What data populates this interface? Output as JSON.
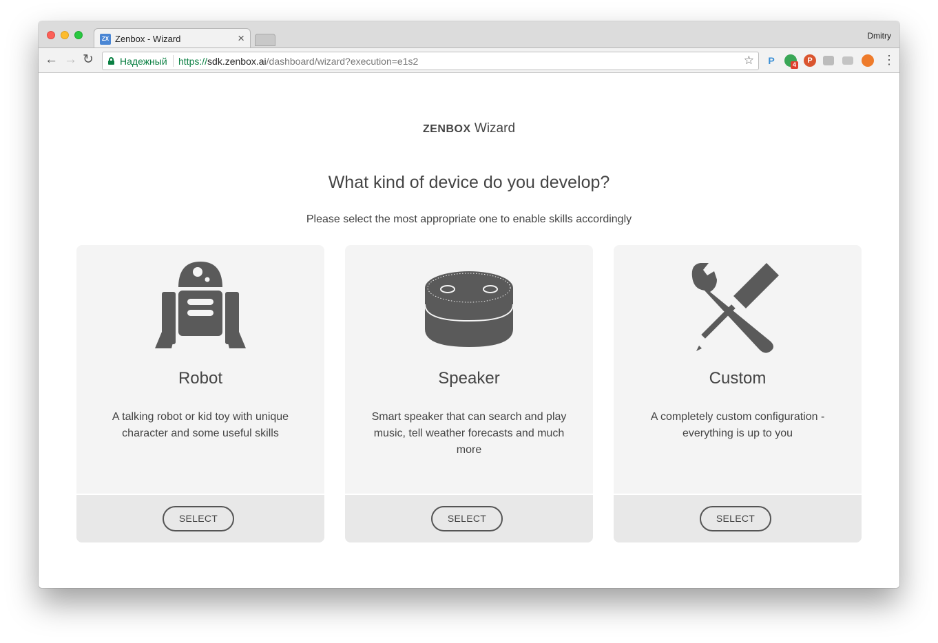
{
  "browser": {
    "tab": {
      "favicon_text": "ZX",
      "title": "Zenbox - Wizard",
      "close_glyph": "×"
    },
    "profile_name": "Dmitry",
    "nav": {
      "back": "←",
      "forward": "→",
      "reload": "↻"
    },
    "address": {
      "secure_label": "Надежный",
      "scheme": "https://",
      "host": "sdk.zenbox.ai",
      "path": "/dashboard/wizard?execution=e1s2",
      "bookmark_glyph": "☆"
    },
    "extensions": {
      "p_blue": "P",
      "green_badge": "4",
      "red": "P",
      "menu_glyph": "⋮"
    }
  },
  "page": {
    "brand_logo": "ZENBOX",
    "brand_suffix": "Wizard",
    "heading": "What kind of device do you develop?",
    "subheading": "Please select the most appropriate one to enable skills accordingly",
    "cards": [
      {
        "icon": "robot-icon",
        "title": "Robot",
        "description": "A talking robot or kid toy with unique character and some useful skills",
        "button": "SELECT"
      },
      {
        "icon": "speaker-icon",
        "title": "Speaker",
        "description": "Smart speaker that can search and play music, tell weather forecasts and much more",
        "button": "SELECT"
      },
      {
        "icon": "tools-icon",
        "title": "Custom",
        "description": "A completely custom configuration - everything is up to you",
        "button": "SELECT"
      }
    ]
  },
  "colors": {
    "icon_fill": "#5a5a5a",
    "card_bg": "#f4f4f4",
    "card_footer_bg": "#e8e8e8",
    "secure_green": "#0b8043"
  }
}
